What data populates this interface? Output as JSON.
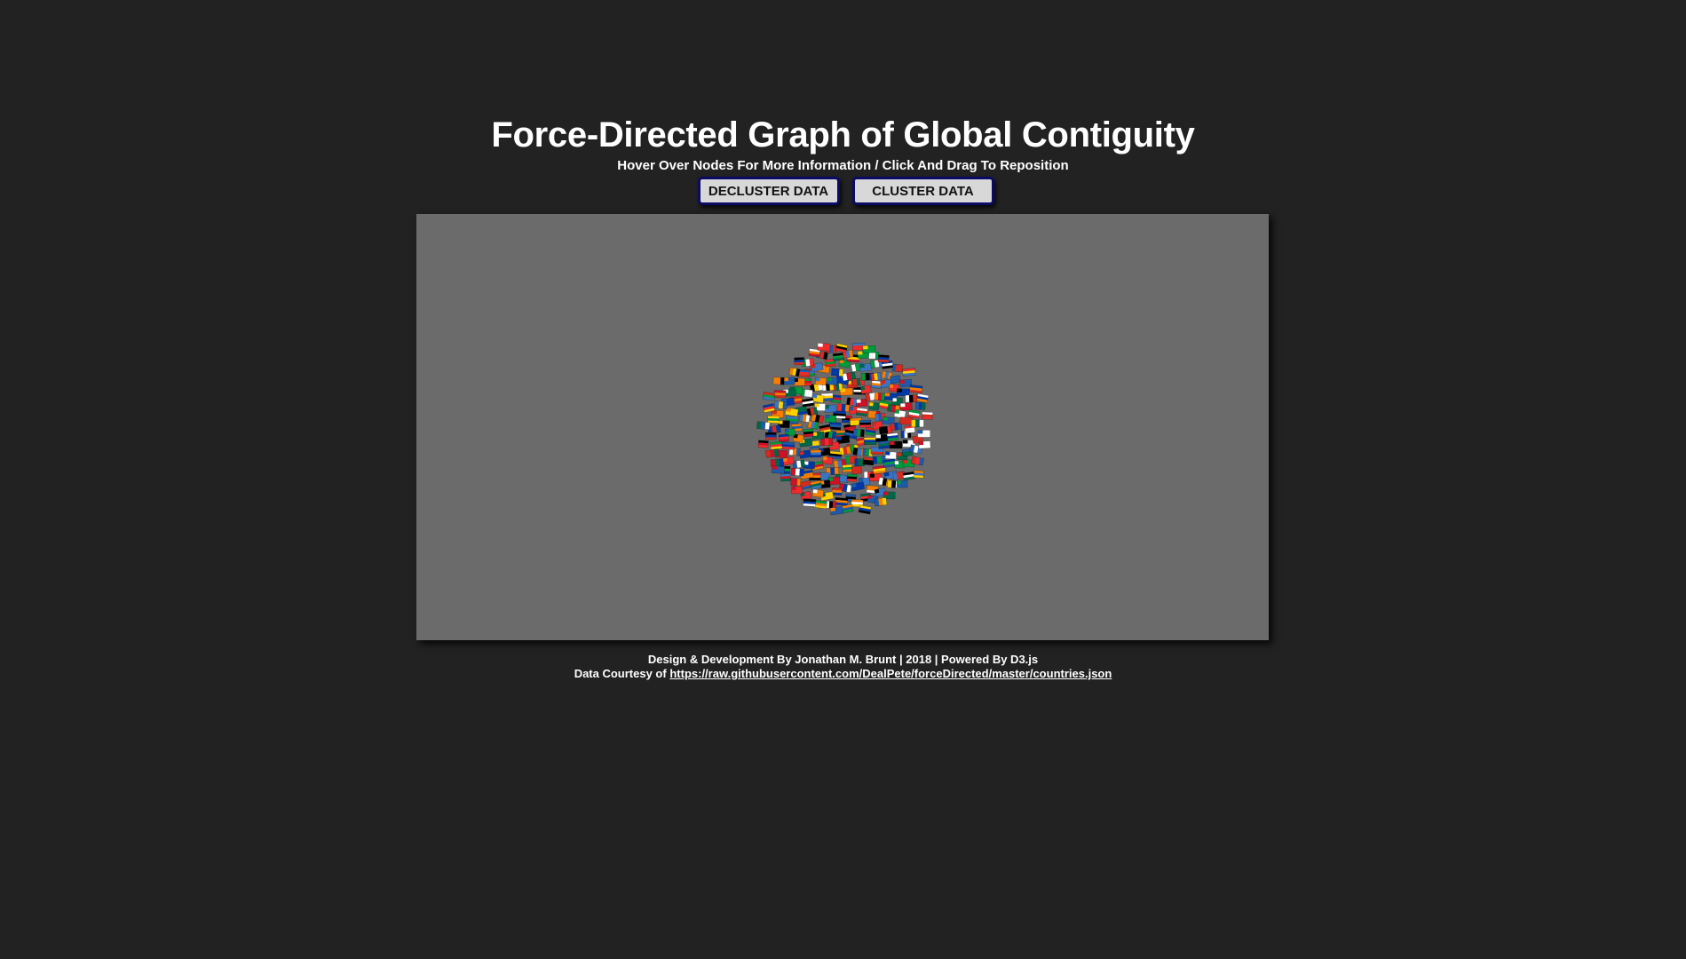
{
  "header": {
    "title": "Force-Directed Graph of Global Contiguity",
    "subtitle": "Hover Over Nodes For More Information / Click And Drag To Reposition"
  },
  "controls": {
    "decluster_label": "DECLUSTER DATA",
    "cluster_label": "CLUSTER DATA"
  },
  "graph": {
    "background_color": "#6b6b6b",
    "node_icon": "country-flag-icon",
    "flag_palette": [
      "#d52b1e",
      "#ffffff",
      "#0039a6",
      "#009b3a",
      "#ffd100",
      "#000000",
      "#ce1126",
      "#006847",
      "#3a75c4",
      "#f77f00",
      "#ef2b2d",
      "#1e5aa8"
    ]
  },
  "footer": {
    "credit": "Design & Development By Jonathan M. Brunt | 2018 | Powered By D3.js",
    "data_prefix": "Data Courtesy of",
    "data_link_text": "https://raw.githubusercontent.com/DealPete/forceDirected/master/countries.json"
  },
  "colors": {
    "page_background": "#222222",
    "button_background": "#d8d8d8",
    "button_border": "#0b0b66"
  }
}
